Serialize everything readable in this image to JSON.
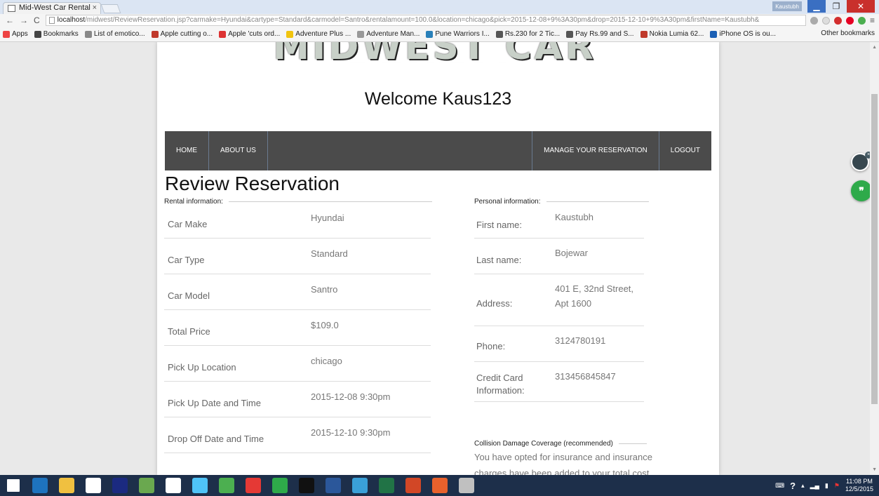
{
  "browser": {
    "tab_title": "Mid-West Car Rental",
    "tab_close": "×",
    "profile_name": "Kaustubh",
    "url_host": "localhost",
    "url_rest": "/midwest/ReviewReservation.jsp?carmake=Hyundai&cartype=Standard&carmodel=Santro&rentalamount=100.0&location=chicago&pick=2015-12-08+9%3A30pm&drop=2015-12-10+9%3A30pm&firstName=Kaustubh&",
    "bookmarks": [
      {
        "label": "Apps",
        "color": "#e44"
      },
      {
        "label": "Bookmarks",
        "color": "#444"
      },
      {
        "label": "List of emotico...",
        "color": "#888"
      },
      {
        "label": "Apple cutting o...",
        "color": "#c0392b"
      },
      {
        "label": "Apple 'cuts ord...",
        "color": "#d33"
      },
      {
        "label": "Adventure Plus ...",
        "color": "#f1c40f"
      },
      {
        "label": "Adventure Man...",
        "color": "#999"
      },
      {
        "label": "Pune Warriors I...",
        "color": "#2980b9"
      },
      {
        "label": "Rs.230 for 2 Tic...",
        "color": "#555"
      },
      {
        "label": "Pay Rs.99 and S...",
        "color": "#555"
      },
      {
        "label": "Nokia Lumia 62...",
        "color": "#c0392b"
      },
      {
        "label": "iPhone OS is ou...",
        "color": "#1a5fb4"
      }
    ],
    "other_bookmarks": "Other bookmarks"
  },
  "page": {
    "logo_text": "MIDWEST CAR RENTAL",
    "welcome": "Welcome Kaus123",
    "nav": {
      "home": "HOME",
      "about": "ABOUT US",
      "manage": "MANAGE YOUR RESERVATION",
      "logout": "LOGOUT"
    },
    "title": "Review Reservation",
    "rental_section": "Rental information:",
    "personal_section": "Personal information:",
    "rental_fields": [
      {
        "label": "Car Make",
        "value": "Hyundai"
      },
      {
        "label": "Car Type",
        "value": "Standard"
      },
      {
        "label": "Car Model",
        "value": "Santro"
      },
      {
        "label": "Total Price",
        "value": "$109.0"
      },
      {
        "label": "Pick Up Location",
        "value": "chicago"
      },
      {
        "label": "Pick Up Date and Time",
        "value": "2015-12-08 9:30pm"
      },
      {
        "label": "Drop Off Date and Time",
        "value": "2015-12-10 9:30pm"
      }
    ],
    "personal_fields": [
      {
        "label": "First name:",
        "value": "Kaustubh"
      },
      {
        "label": "Last name:",
        "value": "Bojewar"
      },
      {
        "label": "Address:",
        "value": "401 E, 32nd Street, Apt 1600"
      },
      {
        "label": "Phone:",
        "value": "3124780191"
      },
      {
        "label": "Credit Card Information:",
        "value": "313456845847"
      }
    ],
    "coverage_section": "Collision Damage Coverage (recommended)",
    "coverage_text": "You have opted for insurance and insurance charges have been added to your total cost."
  },
  "taskbar": {
    "time": "11:08 PM",
    "date": "12/5/2015",
    "apps": [
      "#1e73be",
      "#f0c040",
      "#ffffff",
      "#1b2a80",
      "#6aa84f",
      "#ffffff",
      "#4fc3f7",
      "#4caf50",
      "#e53935",
      "#2eaa4a",
      "#111111",
      "#2b579a",
      "#3aa0d8",
      "#217346",
      "#d24726",
      "#e8612c",
      "#c0c0c0"
    ]
  }
}
